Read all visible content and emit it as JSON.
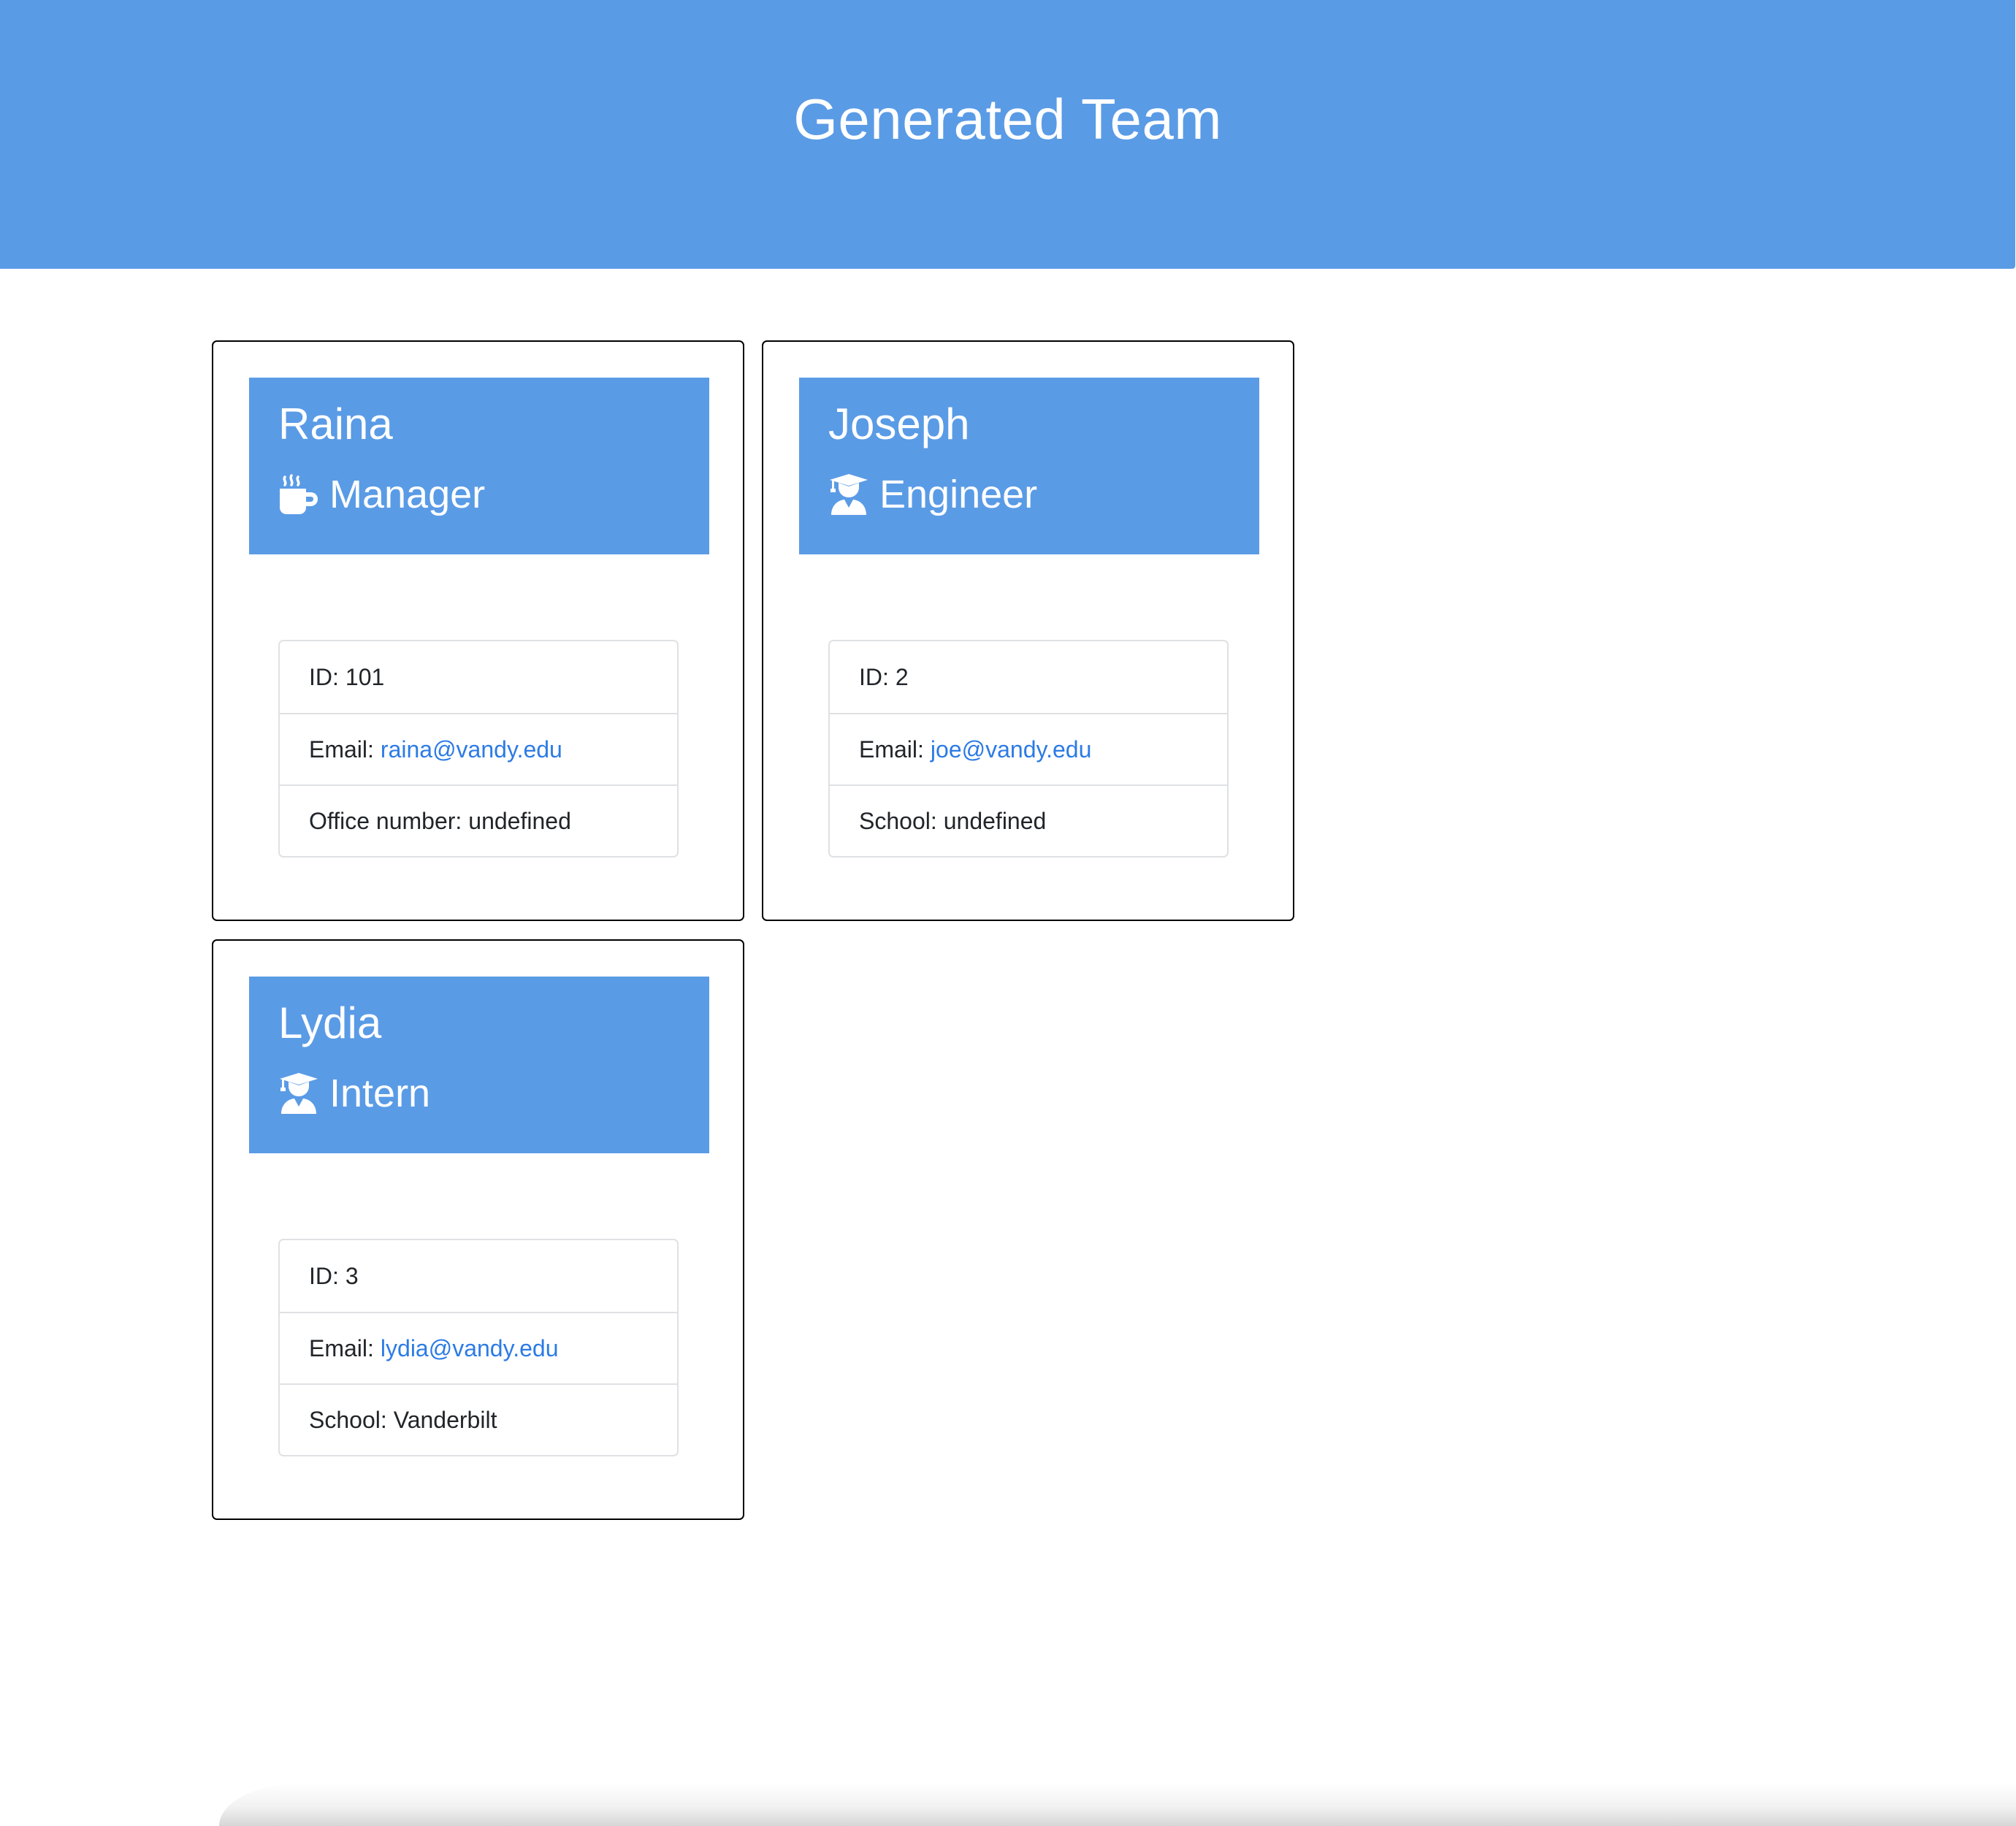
{
  "header": {
    "title": "Generated Team"
  },
  "team": [
    {
      "name": "Raina",
      "role": "Manager",
      "role_icon": "mug-hot-icon",
      "id_label": "ID:",
      "id": "101",
      "email_label": "Email:",
      "email": "raina@vandy.edu",
      "extra_label": "Office number:",
      "extra_value": "undefined"
    },
    {
      "name": "Joseph",
      "role": "Engineer",
      "role_icon": "user-graduate-icon",
      "id_label": "ID:",
      "id": "2",
      "email_label": "Email:",
      "email": "joe@vandy.edu",
      "extra_label": "School:",
      "extra_value": "undefined"
    },
    {
      "name": "Lydia",
      "role": "Intern",
      "role_icon": "user-graduate-icon",
      "id_label": "ID:",
      "id": "3",
      "email_label": "Email:",
      "email": "lydia@vandy.edu",
      "extra_label": "School:",
      "extra_value": "Vanderbilt"
    }
  ],
  "colors": {
    "accent": "#5a9be6",
    "link": "#2c7be5",
    "text": "#212529",
    "border": "#dfe1e4"
  }
}
